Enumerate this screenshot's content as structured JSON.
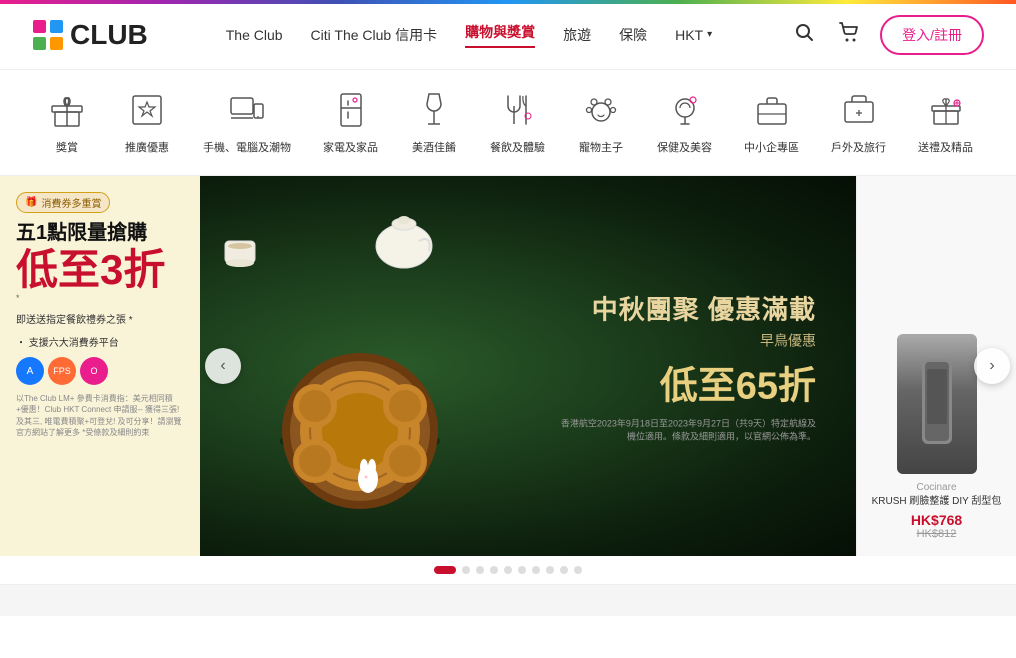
{
  "header": {
    "logo_text": "CLUB",
    "nav_items": [
      {
        "label": "The Club",
        "active": false
      },
      {
        "label": "Citi The Club 信用卡",
        "active": false
      },
      {
        "label": "購物與獎賞",
        "active": true
      },
      {
        "label": "旅遊",
        "active": false
      },
      {
        "label": "保險",
        "active": false
      },
      {
        "label": "HKT",
        "active": false,
        "dropdown": true
      }
    ],
    "search_label": "搜索",
    "cart_label": "購物車",
    "login_label": "登入/註冊"
  },
  "categories": [
    {
      "id": "rewards",
      "label": "獎賞",
      "icon": "gift"
    },
    {
      "id": "promo",
      "label": "推廣優惠",
      "icon": "star"
    },
    {
      "id": "tech",
      "label": "手機、電腦及潮物",
      "icon": "devices"
    },
    {
      "id": "home",
      "label": "家電及家品",
      "icon": "fridge"
    },
    {
      "id": "wine",
      "label": "美酒佳餚",
      "icon": "wine"
    },
    {
      "id": "dining",
      "label": "餐飲及體驗",
      "icon": "dining"
    },
    {
      "id": "pet",
      "label": "寵物主子",
      "icon": "pet"
    },
    {
      "id": "beauty",
      "label": "保健及美容",
      "icon": "beauty"
    },
    {
      "id": "sme",
      "label": "中小企專區",
      "icon": "briefcase"
    },
    {
      "id": "travel",
      "label": "戶外及旅行",
      "icon": "travel"
    },
    {
      "id": "gifts",
      "label": "送禮及精品",
      "icon": "giftbox"
    }
  ],
  "slider": {
    "left_promo": {
      "tag": "消費券多重賞",
      "title": "五1點限量搶購",
      "discount": "低至3折",
      "asterisk": "*",
      "sub": "即送送指定餐飲禮券之張 *",
      "platform": "‧ 支援六大消費券平台",
      "footer": "以The Club LM+ 參費卡消費指：美元相同積+優惠！Club HKT Connect 申請服-- 獲得三張! 及其三, 唯電費積聚+可登兌! 及可分享！請瀏覽官方網站了解更多 *受條款及細則約束"
    },
    "main_banner": {
      "title": "中秋團聚 優惠滿載",
      "subtitle": "早鳥優惠",
      "discount": "低至65折",
      "fine_print": "香港航空2023年9月18日至2023年9月27日（共9天）特定航線及機位適用。條款及細則適用，以官網公佈為準。"
    },
    "right_product": {
      "brand": "Cocinare",
      "name": "KRUSH 刷臉整護 DIY 刮型包",
      "price": "HK$768",
      "price_orig": "HK$812"
    },
    "dots_count": 10,
    "active_dot": 0
  }
}
